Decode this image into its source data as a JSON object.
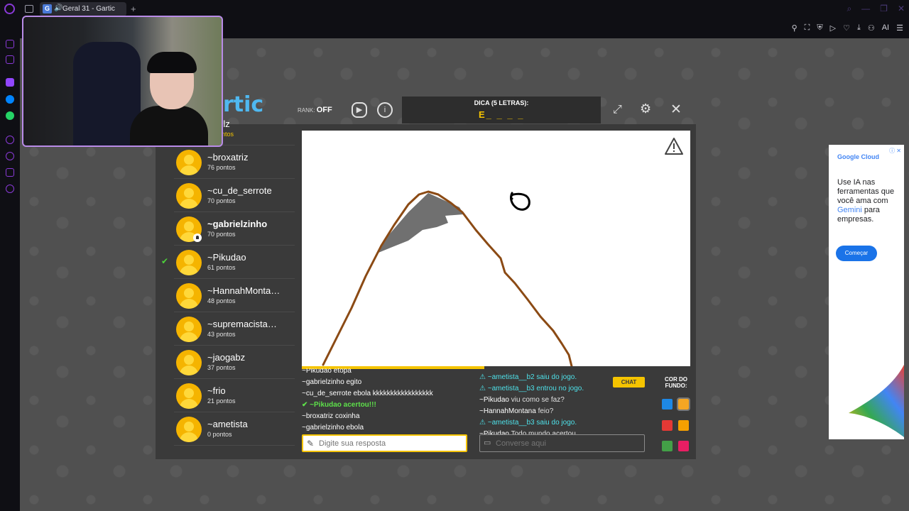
{
  "browser": {
    "tab_title": "Geral 31 - Gartic",
    "tab_favicon": "G",
    "new_tab_label": "+",
    "nav_tools": [
      "AI"
    ]
  },
  "game": {
    "logo": "rtic",
    "rank_label": "RANK:",
    "rank_value": "OFF",
    "hint_label": "DICA (5 LETRAS):",
    "hint_word": "E_ _ _ _",
    "report_icon": "warning-triangle-icon",
    "timer_progress": 0.47,
    "colors": {
      "accent": "#f5c400",
      "panel": "#3a3a3a",
      "correct": "#5de04a",
      "system": "#4ee0e8"
    }
  },
  "players": [
    {
      "name": "...rolz",
      "points": "... pontos",
      "state": "partial"
    },
    {
      "name": "~broxatriz",
      "points": "76 pontos"
    },
    {
      "name": "~cu_de_serrote",
      "points": "70 pontos"
    },
    {
      "name": "~gabrielzinho",
      "points": "70 pontos",
      "bold": true,
      "drawer": true
    },
    {
      "name": "~Pikudao",
      "points": "61 pontos",
      "guessed": true
    },
    {
      "name": "~HannahMonta…",
      "points": "48 pontos"
    },
    {
      "name": "~supremacista…",
      "points": "43 pontos"
    },
    {
      "name": "~jaogabz",
      "points": "37 pontos"
    },
    {
      "name": "~frio",
      "points": "21 pontos"
    },
    {
      "name": "~ametista",
      "points": "0 pontos"
    }
  ],
  "answers": [
    {
      "text": "~Pikudao etopa"
    },
    {
      "text": "~gabrielzinho egito"
    },
    {
      "text": "~cu_de_serrote ebola kkkkkkkkkkkkkkkkk"
    },
    {
      "text": "✔ ~Pikudao acertou!!!",
      "type": "correct"
    },
    {
      "text": "~broxatriz coxinha"
    },
    {
      "text": "~gabrielzinho ebola"
    }
  ],
  "chat": [
    {
      "text": "⚠ ~ametista__b2 saiu do jogo.",
      "type": "system"
    },
    {
      "text": "⚠ ~ametista__b3 entrou no jogo.",
      "type": "system"
    },
    {
      "name": "~Pikudao",
      "text": " viu como se faz?"
    },
    {
      "name": "~HannahMontana",
      "text": " feio?"
    },
    {
      "text": "⚠ ~ametista__b3 saiu do jogo.",
      "type": "system"
    },
    {
      "name": "~Pikudao",
      "text": " Todo mundo acertou"
    }
  ],
  "chat_tab_label": "CHAT",
  "answer_input": {
    "placeholder": "Digite sua resposta",
    "value": ""
  },
  "chat_input": {
    "placeholder": "Converse aqui",
    "value": ""
  },
  "background_label": "COR DO FUNDO:",
  "background_colors": [
    "#1e88e5",
    "#f5a623",
    "#e53935",
    "#f5a000",
    "#43a047",
    "#e91e63"
  ],
  "ad": {
    "brand": "Google Cloud",
    "headline_pre": "Use IA nas ferramentas que você ama com ",
    "headline_brand": "Gemini",
    "headline_post": " para empresas.",
    "cta": "Começar"
  }
}
